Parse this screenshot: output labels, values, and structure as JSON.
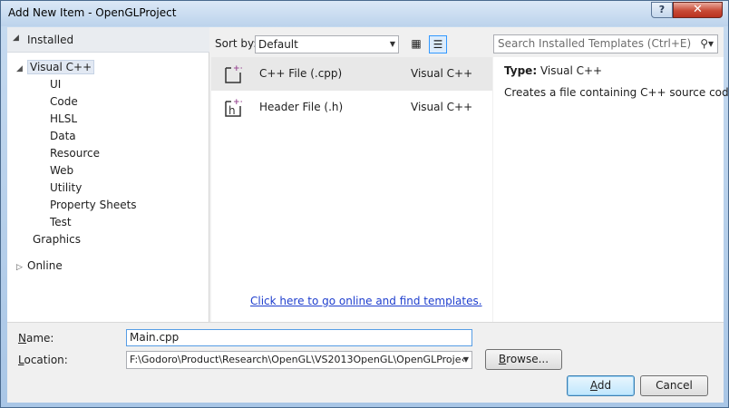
{
  "window": {
    "title": "Add New Item - OpenGLProject",
    "help_label": "?",
    "close_label": "✕"
  },
  "tree": {
    "header": "Installed",
    "root": "Visual C++",
    "children": [
      "UI",
      "Code",
      "HLSL",
      "Data",
      "Resource",
      "Web",
      "Utility",
      "Property Sheets",
      "Test"
    ],
    "graphics": "Graphics",
    "online": "Online"
  },
  "toolbar": {
    "sort_label": "Sort by:",
    "sort_value": "Default",
    "search_placeholder": "Search Installed Templates (Ctrl+E)"
  },
  "templates": [
    {
      "name": "C++ File (.cpp)",
      "lang": "Visual C++",
      "icon": "cpp-file-icon"
    },
    {
      "name": "Header File (.h)",
      "lang": "Visual C++",
      "icon": "header-file-icon"
    }
  ],
  "online_link": "Click here to go online and find templates.",
  "details": {
    "type_label": "Type:",
    "type_value": "Visual C++",
    "description": "Creates a file containing C++ source code"
  },
  "form": {
    "name_label_u": "N",
    "name_label_rest": "ame:",
    "name_value": "Main.cpp",
    "location_label_u": "L",
    "location_label_rest": "ocation:",
    "location_value": "F:\\Godoro\\Product\\Research\\OpenGL\\VS2013OpenGL\\OpenGLProje‹",
    "browse_u": "B",
    "browse_rest": "rowse...",
    "add_u": "A",
    "add_rest": "dd",
    "cancel_label": "Cancel"
  }
}
